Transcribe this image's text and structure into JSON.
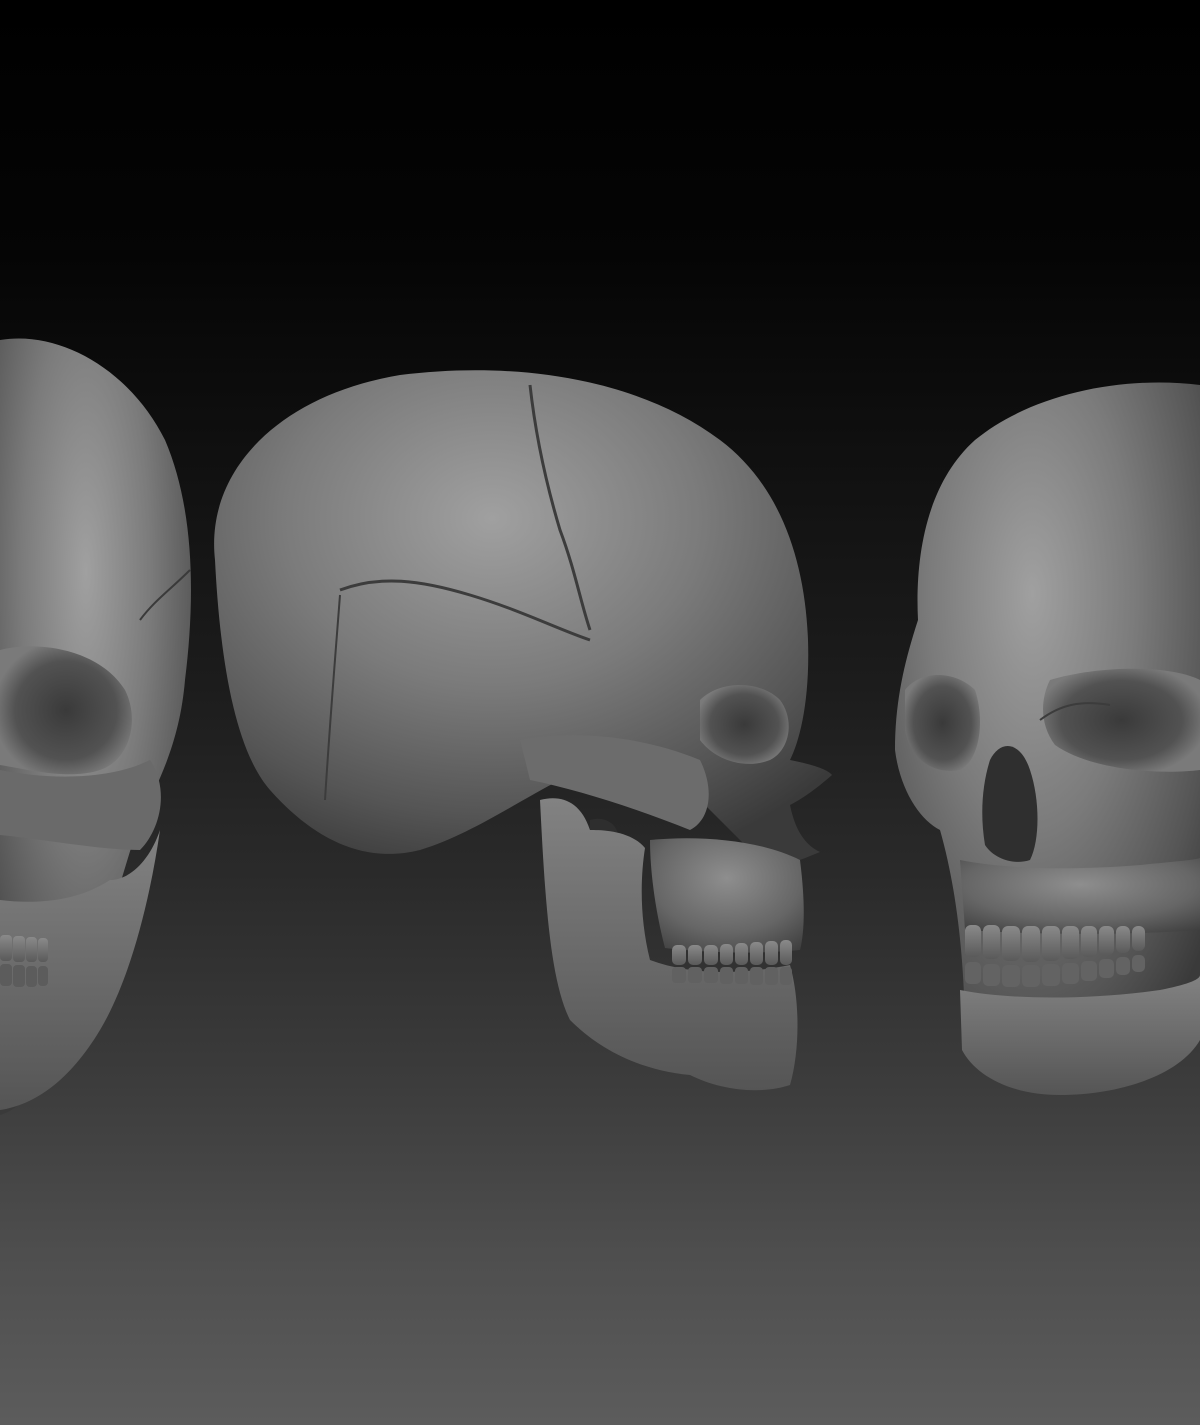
{
  "scene": {
    "subject": "sculpted-skulls",
    "background_top_color": "#000000",
    "background_bottom_color": "#5c5c5c",
    "material_color": "#6e6e6e",
    "views": [
      "three-quarter-front-left",
      "side-profile",
      "three-quarter-front-right"
    ]
  }
}
